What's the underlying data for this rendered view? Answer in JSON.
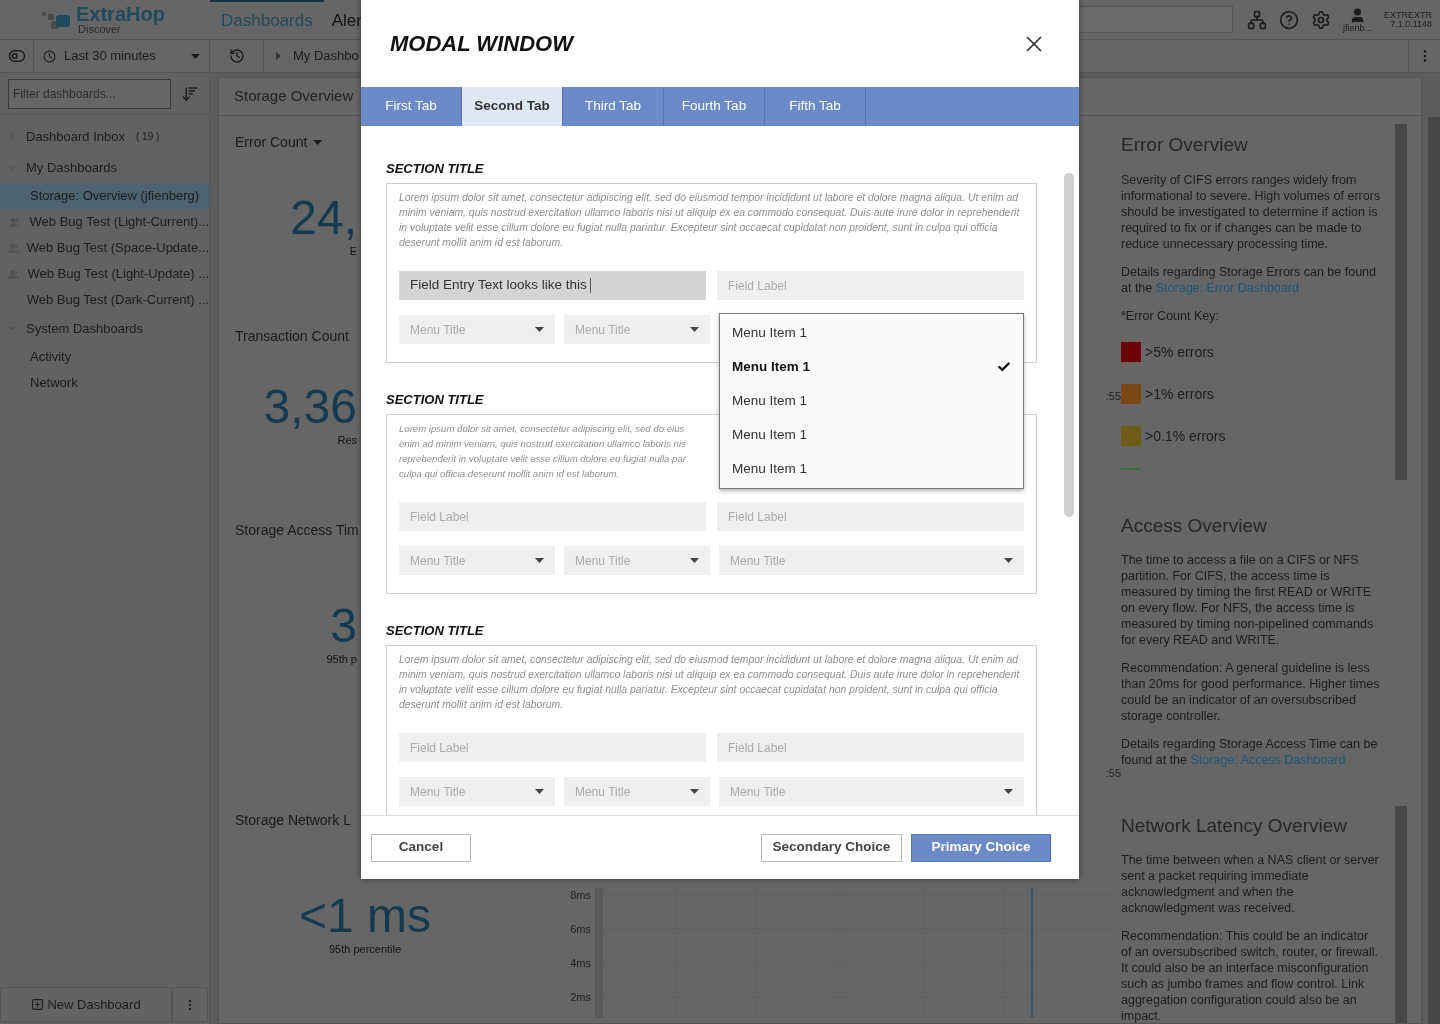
{
  "header": {
    "logo": "ExtraHop",
    "logo_sub": "Discover",
    "nav": [
      {
        "label": "Dashboards",
        "selected": true
      },
      {
        "label": "Aler",
        "selected": false
      }
    ],
    "user": "jfienb...",
    "appliance": "EXTREXTR",
    "version": "7.1.0.1148"
  },
  "toolbar": {
    "time_range": "Last 30 minutes",
    "breadcrumb": "My Dashbo"
  },
  "sidebar": {
    "filter_placeholder": "Filter dashboards...",
    "groups": [
      {
        "label": "Dashboard Inbox",
        "count": "( 19 )",
        "expanded": false
      },
      {
        "label": "My Dashboards",
        "expanded": true,
        "children": [
          {
            "label": "Storage: Overview (jfienberg)",
            "shared": false,
            "selected": true
          },
          {
            "label": "Web Bug Test (Light-Current)...",
            "shared": true,
            "selected": false
          },
          {
            "label": "Web Bug Test (Space-Update...",
            "shared": true,
            "selected": false
          },
          {
            "label": "Web Bug Test (Light-Update) ...",
            "shared": true,
            "selected": false
          },
          {
            "label": "Web Bug Test (Dark-Current) ...",
            "shared": false,
            "selected": false
          }
        ]
      },
      {
        "label": "System Dashboards",
        "expanded": true,
        "children": [
          {
            "label": "Activity",
            "shared": false,
            "selected": false
          },
          {
            "label": "Network",
            "shared": false,
            "selected": false
          }
        ]
      }
    ],
    "new_dashboard": "New Dashboard"
  },
  "dashboard": {
    "title": "Storage Overview",
    "widgets": [
      {
        "title": "Error Count",
        "menu": true,
        "value": "24,",
        "caption": "E"
      },
      {
        "title": "Transaction Count",
        "menu": false,
        "value": "3,36",
        "caption": "Res",
        "axis_label": ":55"
      },
      {
        "title": "Storage Access Tim",
        "menu": false,
        "value": "3",
        "caption": "95th p",
        "axis_label": ":55"
      },
      {
        "title": "Storage Network L",
        "menu": false,
        "value": "<1 ms",
        "caption": "95th percentile",
        "ticks": [
          "8ms",
          "6ms",
          "4ms",
          "2ms"
        ]
      }
    ]
  },
  "info_panel": {
    "sections": [
      {
        "title": "Error Overview",
        "paragraphs": [
          {
            "text": "Severity of CIFS errors ranges widely from informational to severe. High volumes of errors should be investigated to determine if action is required to fix or if changes can be made to reduce unnecessary processing time."
          },
          {
            "text": "Details regarding Storage Errors can be found at the ",
            "link": "Storage: Error Dashboard"
          },
          {
            "text": "*Error Count Key:"
          }
        ],
        "key": [
          {
            "label": ">5% errors",
            "color": "#6e0008"
          },
          {
            "label": ">1% errors",
            "color": "#7a4814"
          },
          {
            "label": ">0.1% errors",
            "color": "#6e5c18"
          },
          {
            "color": "#3f6e45"
          }
        ]
      },
      {
        "title": "Access Overview",
        "paragraphs": [
          {
            "text": "The time to access a file on a CIFS or NFS partition. For CIFS, the access time is measured by timing the first READ or WRITE on every flow. For NFS, the access time is measured by timing non-pipelined commands for every READ and WRITE."
          },
          {
            "text": "Recommendation: A general guideline is less than 20ms for good performance. Higher times could be an indicator of an oversubscribed storage controller."
          },
          {
            "text": "Details regarding Storage Access Time can be found at the ",
            "link": "Storage: Access Dashboard"
          }
        ]
      },
      {
        "title": "Network Latency Overview",
        "paragraphs": [
          {
            "text": "The time between when a NAS client or server sent a packet requiring immediate acknowledgment and when the acknowledgment was received."
          },
          {
            "text": "Recommendation: This could be an indicator of an oversubscribed switch, router, or firewall. It could also be an interface misconfiguration such as jumbo frames and flow control. Link aggregation configuration could also be an impact."
          }
        ]
      }
    ]
  },
  "modal": {
    "title": "MODAL WINDOW",
    "tabs": [
      {
        "label": "First Tab",
        "selected": false
      },
      {
        "label": "Second Tab",
        "selected": true
      },
      {
        "label": "Third Tab",
        "selected": false
      },
      {
        "label": "Fourth Tab",
        "selected": false
      },
      {
        "label": "Fifth Tab",
        "selected": false
      }
    ],
    "sections": [
      {
        "title": "SECTION TITLE",
        "description": "Lorem ipsum dolor sit amet, consectetur adipiscing elit, sed do eiusmod tempor incididunt ut labore et dolore magna aliqua. Ut enim ad minim veniam, quis nostrud exercitation ullamco laboris nisi ut aliquip ex ea commodo consequat. Duis aute irure dolor in reprehenderit in voluptate velit esse cillum dolore eu fugiat nulla pariatur. Excepteur sint occaecat cupidatat non proident, sunt in culpa qui officia deserunt mollit anim id est laborum.",
        "fields": [
          {
            "value": "Field Entry Text looks like this"
          },
          {
            "placeholder": "Field Label"
          }
        ],
        "menus": [
          {
            "label": "Menu Title",
            "open": false
          },
          {
            "label": "Menu Title",
            "open": false
          },
          {
            "open": true,
            "items": [
              {
                "label": "Menu Item 1",
                "selected": false
              },
              {
                "label": "Menu Item 1",
                "selected": true
              },
              {
                "label": "Menu Item 1",
                "selected": false
              },
              {
                "label": "Menu Item 1",
                "selected": false
              },
              {
                "label": "Menu Item 1",
                "selected": false
              }
            ]
          }
        ]
      },
      {
        "title": "SECTION TITLE",
        "lines": [
          "Lorem ipsum dolor sit amet, consectetur adipiscing elit, sed do eius",
          "enim ad minim veniam, quis nostrud exercitation ullamco laboris nis",
          "reprehenderit in voluptate velit esse cillum dolore eu fugiat nulla par",
          "culpa qui officia deserunt mollit anim id est laborum."
        ],
        "fields": [
          {
            "placeholder": "Field Label"
          },
          {
            "placeholder": "Field Label"
          }
        ],
        "menus": [
          {
            "label": "Menu Title",
            "open": false
          },
          {
            "label": "Menu Title",
            "open": false
          },
          {
            "label": "Menu Title",
            "open": false
          }
        ]
      },
      {
        "title": "SECTION TITLE",
        "description": "Lorem ipsum dolor sit amet, consectetur adipiscing elit, sed do eiusmod tempor incididunt ut labore et dolore magna aliqua. Ut enim ad minim veniam, quis nostrud exercitation ullamco laboris nisi ut aliquip ex ea commodo consequat. Duis aute irure dolor in reprehenderit in voluptate velit esse cillum dolore eu fugiat nulla pariatur. Excepteur sint occaecat cupidatat non proident, sunt in culpa qui officia deserunt mollit anim id est laborum.",
        "fields": [
          {
            "placeholder": "Field Label"
          },
          {
            "placeholder": "Field Label"
          }
        ],
        "menus": [
          {
            "label": "Menu Title",
            "open": false
          },
          {
            "label": "Menu Title",
            "open": false
          },
          {
            "label": "Menu Title",
            "open": false
          }
        ]
      }
    ],
    "buttons": {
      "cancel": "Cancel",
      "secondary": "Secondary Choice",
      "primary": "Primary Choice"
    }
  }
}
